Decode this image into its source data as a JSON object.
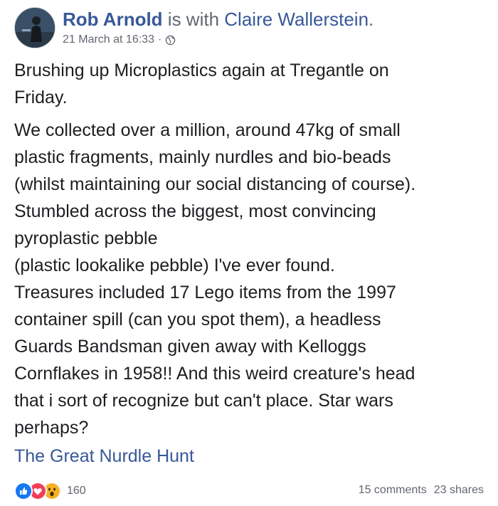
{
  "post": {
    "author": "Rob Arnold",
    "with_text": "is with",
    "tagged": "Claire Wallerstein",
    "tagged_suffix": ".",
    "timestamp": "21 March at 16:33",
    "separator": "·",
    "privacy_icon": "globe-icon",
    "paragraph1": [
      "Brushing up Microplastics again at Tregantle on",
      "Friday."
    ],
    "paragraph2": [
      "We collected over a million, around 47kg of small",
      "plastic fragments, mainly nurdles and bio-beads",
      "(whilst maintaining our social distancing of course).",
      "Stumbled across the biggest, most convincing",
      "pyroplastic pebble",
      "(plastic lookalike pebble) I've ever found.",
      "Treasures included 17 Lego items from the 1997",
      "container spill (can you spot them), a headless",
      "Guards Bandsman given away with Kelloggs",
      "Cornflakes in 1958!! And this weird creature's head",
      "that i sort of recognize but can't place. Star wars",
      "perhaps?"
    ],
    "page_link": "The Great Nurdle Hunt"
  },
  "footer": {
    "reactions": [
      "like-icon",
      "love-icon",
      "wow-icon"
    ],
    "reaction_count": "160",
    "comments": "15 comments",
    "shares": "23 shares"
  },
  "colors": {
    "link": "#385898",
    "secondary": "#616770",
    "text": "#1c1e21",
    "like": "#1877f2",
    "love": "#f33e58",
    "wow": "#f7b125"
  }
}
